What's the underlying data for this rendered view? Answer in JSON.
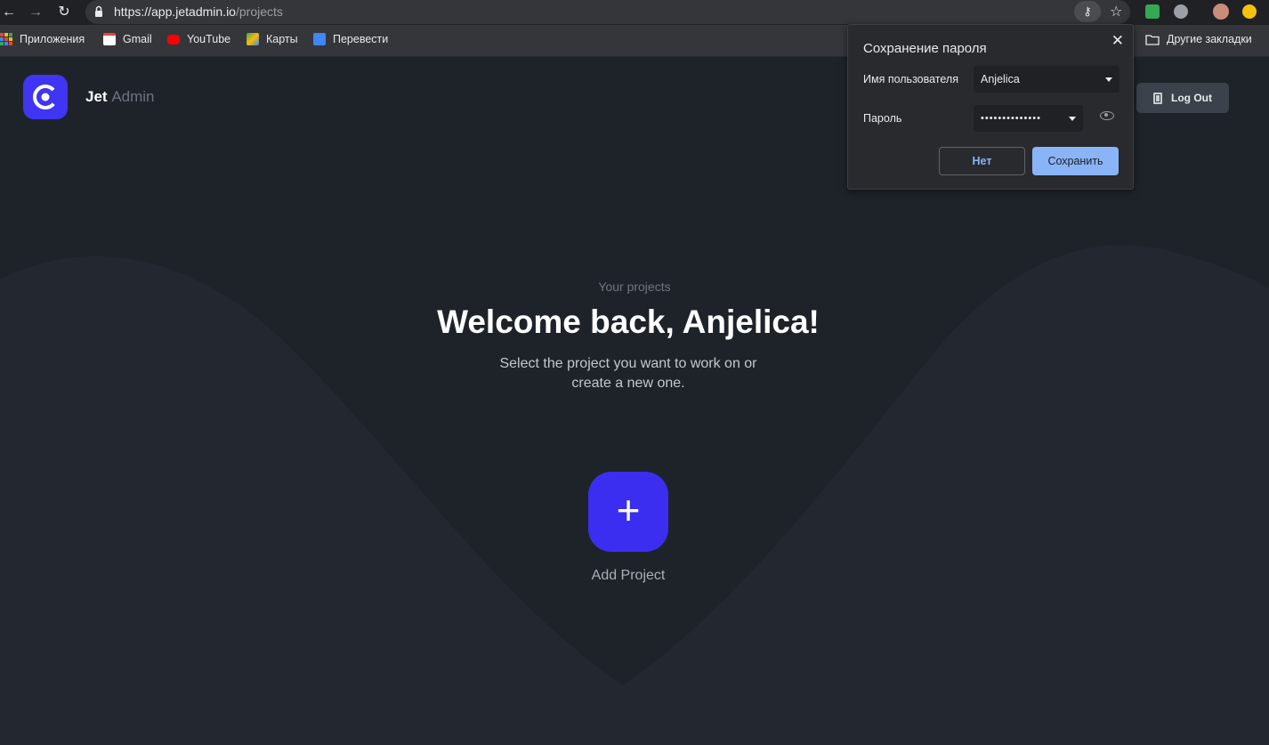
{
  "browser": {
    "url_main": "https://app.jetadmin.io",
    "url_path": "/projects",
    "icons": {
      "back": "back-arrow-icon",
      "forward": "forward-arrow-icon",
      "reload": "reload-icon",
      "lock": "lock-icon",
      "key": "key-icon",
      "star": "star-icon"
    }
  },
  "bookmarks": {
    "items": [
      {
        "label": "Приложения",
        "icon": "apps-grid-icon"
      },
      {
        "label": "Gmail",
        "icon": "gmail-icon"
      },
      {
        "label": "YouTube",
        "icon": "youtube-icon"
      },
      {
        "label": "Карты",
        "icon": "maps-icon"
      },
      {
        "label": "Перевести",
        "icon": "translate-icon"
      }
    ],
    "other": "Другие закладки"
  },
  "app": {
    "brand_main": "Jet",
    "brand_sub": "Admin",
    "logout_label": "Log Out",
    "subtitle": "Your projects",
    "headline": "Welcome back, Anjelica!",
    "description": "Select the project you want to work on or create a new one.",
    "add_label": "Add Project",
    "colors": {
      "accent": "#3c2ef0",
      "background": "#1e2329",
      "wave": "#232830"
    }
  },
  "dialog": {
    "title": "Сохранение пароля",
    "username_label": "Имя пользователя",
    "username_value": "Anjelica",
    "password_label": "Пароль",
    "password_value": "••••••••••••••",
    "no_label": "Нет",
    "save_label": "Сохранить",
    "colors": {
      "primary": "#8ab4f8"
    }
  }
}
